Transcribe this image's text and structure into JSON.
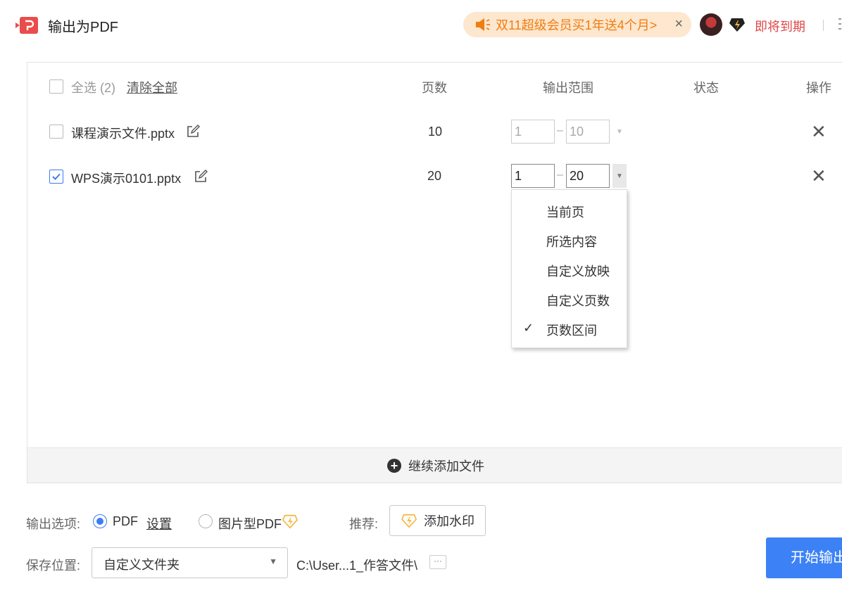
{
  "title_bar": {
    "title": "输出为PDF",
    "app_icon": "wps-pdf-icon",
    "promo_text": "双11超级会员买1年送4个月>",
    "promo_close": "×",
    "expire_text": "即将到期"
  },
  "table": {
    "select_all_label": "全选 (2)",
    "clear_all_label": "清除全部",
    "columns": {
      "pages": "页数",
      "range": "输出范围",
      "status": "状态",
      "action": "操作"
    },
    "rows": [
      {
        "name": "课程演示文件.pptx",
        "checked": false,
        "pages": "10",
        "range_from": "1",
        "range_to": "10"
      },
      {
        "name": "WPS演示0101.pptx",
        "checked": true,
        "pages": "20",
        "range_from": "1",
        "range_to": "20"
      }
    ],
    "range_separator": "–",
    "delete_glyph": "✕"
  },
  "range_menu": {
    "items": [
      "当前页",
      "所选内容",
      "自定义放映",
      "自定义页数",
      "页数区间"
    ],
    "selected": "页数区间",
    "check_glyph": "✓"
  },
  "add_files": {
    "label": "继续添加文件",
    "plus_glyph": "+"
  },
  "options": {
    "output_label": "输出选项:",
    "pdf_label": "PDF",
    "settings_label": "设置",
    "image_pdf_label": "图片型PDF",
    "recommend_label": "推荐:",
    "watermark_button": "添加水印",
    "save_label": "保存位置:",
    "save_select_value": "自定义文件夹",
    "save_path": "C:\\User...1_作答文件\\",
    "browse_glyph": "···",
    "start_button": "开始输出"
  },
  "colors": {
    "accent": "#3c82f6",
    "promo_bg": "#fde7cf",
    "promo_text": "#f07d10",
    "expire_text": "#e04848",
    "vip_gold": "#f4b63c"
  }
}
